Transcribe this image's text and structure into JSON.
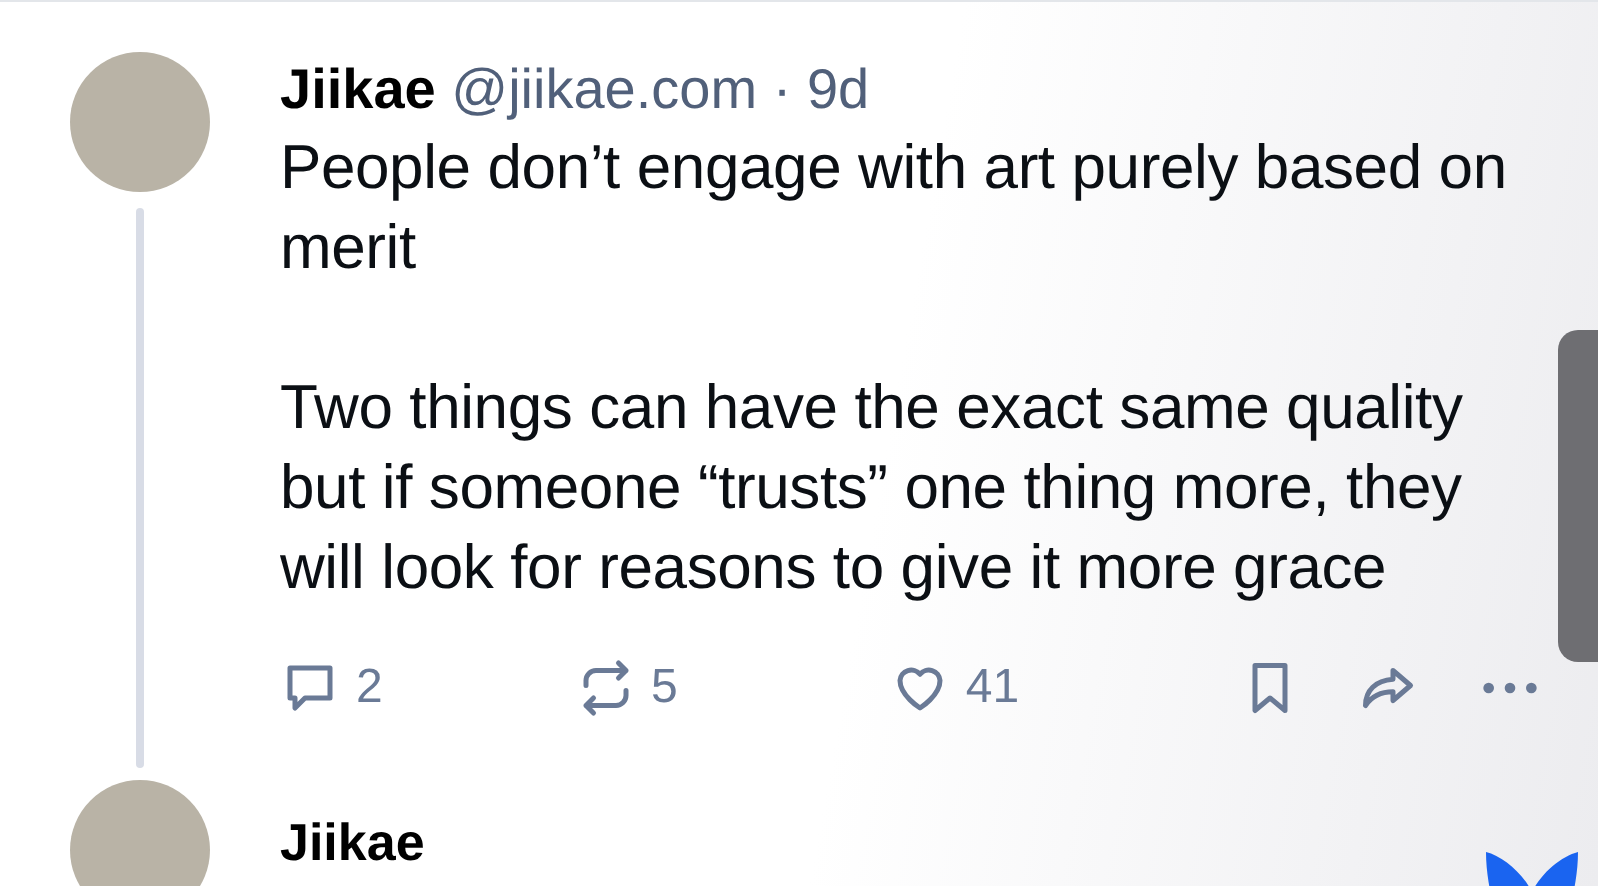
{
  "post": {
    "author": "Jiikae",
    "handle": "@jiikae.com",
    "separator": "·",
    "time": "9d",
    "paragraphs": [
      "People don’t engage with art purely based on merit",
      "Two things can have the exact same quality but if someone “trusts” one thing more, they will look for reasons to give it more grace"
    ],
    "actions": [
      {
        "kind": "reply",
        "count": "2"
      },
      {
        "kind": "repost",
        "count": "5"
      },
      {
        "kind": "like",
        "count": "41"
      },
      {
        "kind": "bookmark"
      },
      {
        "kind": "share"
      },
      {
        "kind": "more"
      }
    ]
  },
  "next_post": {
    "author": "Jiikae"
  }
}
